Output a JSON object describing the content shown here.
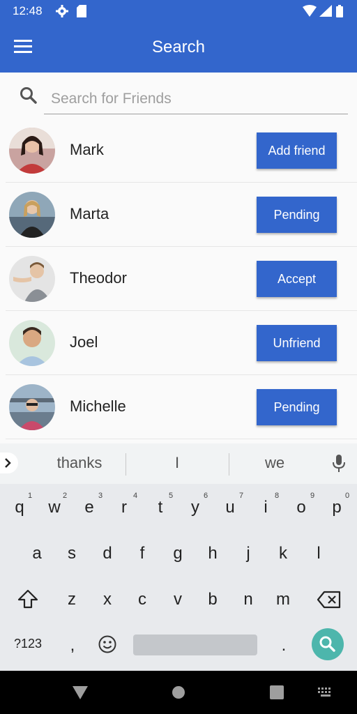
{
  "status_bar": {
    "time": "12:48"
  },
  "app_bar": {
    "title": "Search"
  },
  "search": {
    "placeholder": "Search for Friends",
    "value": ""
  },
  "friends": [
    {
      "name": "Mark",
      "action": "Add friend"
    },
    {
      "name": "Marta",
      "action": "Pending"
    },
    {
      "name": "Theodor",
      "action": "Accept"
    },
    {
      "name": "Joel",
      "action": "Unfriend"
    },
    {
      "name": "Michelle",
      "action": "Pending"
    }
  ],
  "keyboard": {
    "suggestions": [
      "thanks",
      "I",
      "we"
    ],
    "row1": [
      "q",
      "w",
      "e",
      "r",
      "t",
      "y",
      "u",
      "i",
      "o",
      "p"
    ],
    "row1_hints": [
      "1",
      "2",
      "3",
      "4",
      "5",
      "6",
      "7",
      "8",
      "9",
      "0"
    ],
    "row2": [
      "a",
      "s",
      "d",
      "f",
      "g",
      "h",
      "j",
      "k",
      "l"
    ],
    "row3": [
      "z",
      "x",
      "c",
      "v",
      "b",
      "n",
      "m"
    ],
    "symbols_key": "?123",
    "comma_key": ",",
    "period_key": "."
  },
  "colors": {
    "accent": "#3366cc",
    "search_key": "#4db6ac"
  }
}
